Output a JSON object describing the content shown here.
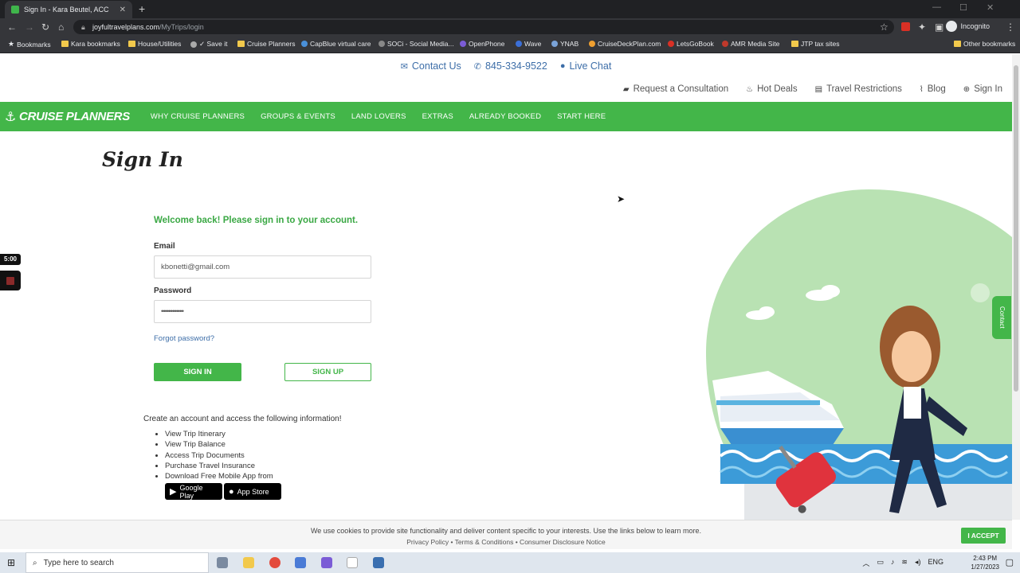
{
  "browser": {
    "tab_title": "Sign In - Kara Beutel, ACC",
    "url_host": "joyfultravelplans.com",
    "url_path": "/MyTrips/login",
    "profile_label": "Incognito",
    "bookmarks": [
      "Bookmarks",
      "Kara bookmarks",
      "House/Utilities",
      "✓ Save it",
      "Cruise Planners",
      "CapBlue virtual care",
      "SOCi - Social Media...",
      "OpenPhone",
      "Wave",
      "YNAB",
      "CruiseDeckPlan.com",
      "LetsGoBook",
      "AMR Media Site",
      "JTP tax sites",
      "Other bookmarks"
    ]
  },
  "top_contact": {
    "contact_us": "Contact Us",
    "phone": "845-334-9522",
    "live_chat": "Live Chat"
  },
  "util_nav": {
    "consultation": "Request a Consultation",
    "hot_deals": "Hot Deals",
    "travel_restrictions": "Travel Restrictions",
    "blog": "Blog",
    "sign_in": "Sign In"
  },
  "main_nav": {
    "logo": "CRUISE PLANNERS",
    "items": [
      "WHY CRUISE PLANNERS",
      "GROUPS & EVENTS",
      "LAND LOVERS",
      "EXTRAS",
      "ALREADY BOOKED",
      "START HERE"
    ]
  },
  "page_title": "Sign In",
  "form": {
    "welcome": "Welcome back! Please sign in to your account.",
    "email_label": "Email",
    "email_value": "kbonetti@gmail.com",
    "password_label": "Password",
    "password_value": "••••••••••••",
    "forgot": "Forgot password?",
    "signin_button": "SIGN IN",
    "signup_button": "SIGN UP"
  },
  "benefits": {
    "intro": "Create an account and access the following information!",
    "items": [
      "View Trip Itinerary",
      "View Trip Balance",
      "Access Trip Documents",
      "Purchase Travel Insurance",
      "Download Free Mobile App from"
    ],
    "google_play": "Google Play",
    "app_store": "App Store"
  },
  "widgets": {
    "timer": "5:00",
    "contact_tab": "Contact"
  },
  "cookie": {
    "text": "We use cookies to provide site functionality and deliver content specific to your interests. Use the links below to learn more.",
    "links": "Privacy Policy • Terms & Conditions • Consumer Disclosure Notice",
    "accept": "I ACCEPT"
  },
  "taskbar": {
    "search_placeholder": "Type here to search",
    "language": "ENG",
    "time": "2:43 PM",
    "date": "1/27/2023"
  },
  "colors": {
    "brand_green": "#43b649",
    "link_blue": "#3d6ea8"
  }
}
